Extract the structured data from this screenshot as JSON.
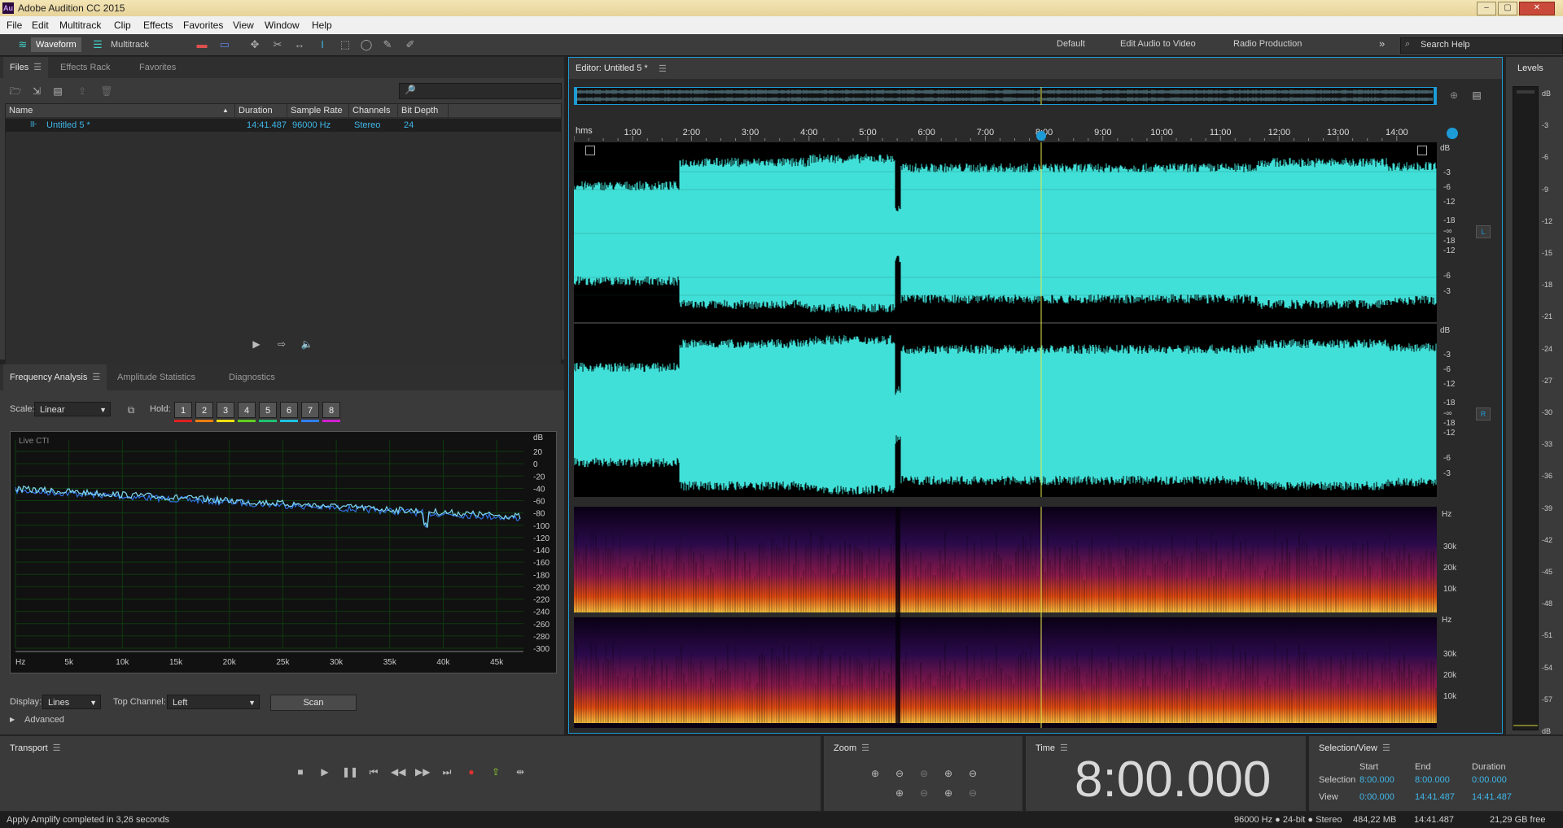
{
  "app": {
    "title": "Adobe Audition CC 2015",
    "icon_text": "Au"
  },
  "window_buttons": [
    "–",
    "▢",
    "✕"
  ],
  "menu": [
    "File",
    "Edit",
    "Multitrack",
    "Clip",
    "Effects",
    "Favorites",
    "View",
    "Window",
    "Help"
  ],
  "toolbar": {
    "waveform_label": "Waveform",
    "multitrack_label": "Multitrack"
  },
  "workspaces": [
    "Default",
    "Edit Audio to Video",
    "Radio Production"
  ],
  "search": {
    "placeholder": "Search Help"
  },
  "files_panel": {
    "tabs": [
      "Files",
      "Effects Rack",
      "Favorites"
    ],
    "search_icon": "🔎",
    "columns": [
      "Name",
      "Duration",
      "Sample Rate",
      "Channels",
      "Bit Depth"
    ],
    "rows": [
      {
        "name": "Untitled 5 *",
        "duration": "14:41.487",
        "sample_rate": "96000 Hz",
        "channels": "Stereo",
        "bit_depth": "24"
      }
    ]
  },
  "analysis_panel": {
    "tabs": [
      "Frequency Analysis",
      "Amplitude Statistics",
      "Diagnostics"
    ],
    "scale_label": "Scale:",
    "scale_value": "Linear",
    "hold_label": "Hold:",
    "hold_buttons": [
      "1",
      "2",
      "3",
      "4",
      "5",
      "6",
      "7",
      "8"
    ],
    "hold_colors": [
      "#e02020",
      "#f07c10",
      "#f0e010",
      "#60d020",
      "#20c070",
      "#20c0e0",
      "#3080f0",
      "#d020d0"
    ],
    "graph_label": "Live CTI",
    "db_unit": "dB",
    "db_ticks": [
      "20",
      "0",
      "-20",
      "-40",
      "-60",
      "-80",
      "-100",
      "-120",
      "-140",
      "-160",
      "-180",
      "-200",
      "-220",
      "-240",
      "-260",
      "-280",
      "-300"
    ],
    "hz_ticks": [
      "Hz",
      "5k",
      "10k",
      "15k",
      "20k",
      "25k",
      "30k",
      "35k",
      "40k",
      "45k"
    ],
    "display_label": "Display:",
    "display_value": "Lines",
    "top_channel_label": "Top Channel:",
    "top_channel_value": "Left",
    "scan_label": "Scan",
    "advanced_label": "Advanced"
  },
  "editor": {
    "tab_label": "Editor: Untitled 5 *",
    "time_unit": "hms",
    "time_ticks": [
      "1:00",
      "2:00",
      "3:00",
      "4:00",
      "5:00",
      "6:00",
      "7:00",
      "8:00",
      "9:00",
      "10:00",
      "11:00",
      "12:00",
      "13:00",
      "14:00"
    ],
    "db_unit": "dB",
    "db_labels": [
      "-3",
      "-6",
      "-12",
      "-18",
      "-∞",
      "-18",
      "-12",
      "-6",
      "-3"
    ],
    "hz_unit": "Hz",
    "hz_labels": [
      "30k",
      "20k",
      "10k"
    ],
    "channel_l": "L",
    "channel_r": "R",
    "waveform_color": "#40e0d8",
    "playhead_color": "#e8e84a"
  },
  "levels": {
    "title": "Levels",
    "ticks": [
      "dB",
      "-3",
      "-6",
      "-9",
      "-12",
      "-15",
      "-18",
      "-21",
      "-24",
      "-27",
      "-30",
      "-33",
      "-36",
      "-39",
      "-42",
      "-45",
      "-48",
      "-51",
      "-54",
      "-57",
      "dB"
    ]
  },
  "transport": {
    "title": "Transport"
  },
  "zoom": {
    "title": "Zoom"
  },
  "time": {
    "title": "Time",
    "value": "8:00.000"
  },
  "selection_view": {
    "title": "Selection/View",
    "headers": [
      "Start",
      "End",
      "Duration"
    ],
    "selection_label": "Selection",
    "selection": [
      "8:00.000",
      "8:00.000",
      "0:00.000"
    ],
    "view_label": "View",
    "view": [
      "0:00.000",
      "14:41.487",
      "14:41.487"
    ]
  },
  "status": {
    "message": "Apply Amplify completed in 3,26 seconds",
    "format": "96000 Hz ● 24-bit ● Stereo",
    "size": "484,22 MB",
    "duration": "14:41.487",
    "free": "21,29 GB free"
  }
}
